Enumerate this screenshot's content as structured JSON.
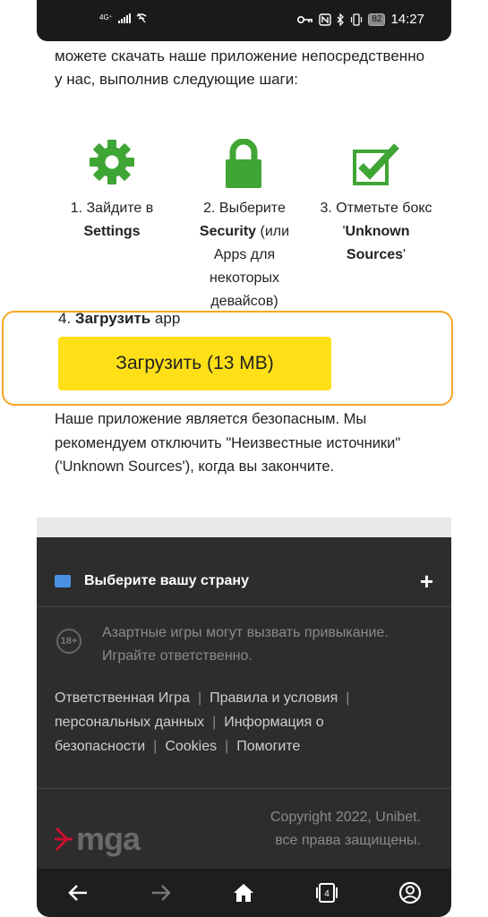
{
  "status_bar": {
    "network": "4G⁺",
    "battery": "82",
    "time": "14:27"
  },
  "intro_text": "можете скачать наше приложение непосредственно у нас, выполнив следующие шаги:",
  "steps": [
    {
      "prefix": "1. Зайдите в",
      "bold": "Settings",
      "suffix": "",
      "icon": "gear-icon"
    },
    {
      "prefix": "2. Выберите",
      "bold": "Security",
      "suffix": "(или Apps для некоторых девайсов)",
      "icon": "lock-icon"
    },
    {
      "prefix": "3. Отметьте бокс '",
      "bold": "Unknown Sources",
      "suffix": "'",
      "icon": "checkbox-icon"
    }
  ],
  "step4": {
    "prefix": "4.",
    "bold": "Загрузить",
    "suffix": "app"
  },
  "download_button": "Загрузить (13 MB)",
  "safety_text": "Наше приложение является безопасным. Мы рекомендуем отключить \"Неизвестные источники\" ('Unknown Sources'), когда вы закончите.",
  "footer": {
    "country_label": "Выберите вашу страну",
    "age_badge": "18+",
    "age_text": "Азартные игры могут вызвать привыкание. Играйте ответственно.",
    "links": [
      "Ответственная Игра",
      "Правила и условия",
      "персональных данных",
      "Информация о безопасности",
      "Cookies",
      "Помогите"
    ],
    "mga_logo": "mga",
    "copyright": "Copyright 2022, Unibet.",
    "rights": "все права защищены."
  },
  "navbar": {
    "tabs_count": "4"
  },
  "colors": {
    "accent_green": "#3fa535",
    "button_yellow": "#ffe016",
    "highlight_orange": "#f5a623",
    "footer_bg": "#2d2d2d"
  }
}
